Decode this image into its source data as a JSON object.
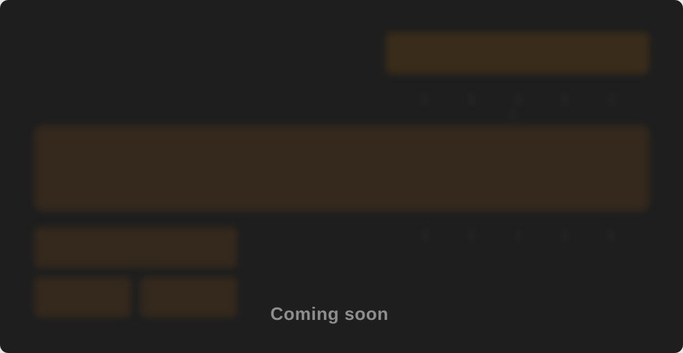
{
  "overlay": {
    "message": "Coming soon"
  },
  "colors": {
    "panel_background": "#1e1e1e",
    "accent_block": "#35291d",
    "button_background": "#3a2c1a",
    "message_text": "#8e8e8e"
  }
}
